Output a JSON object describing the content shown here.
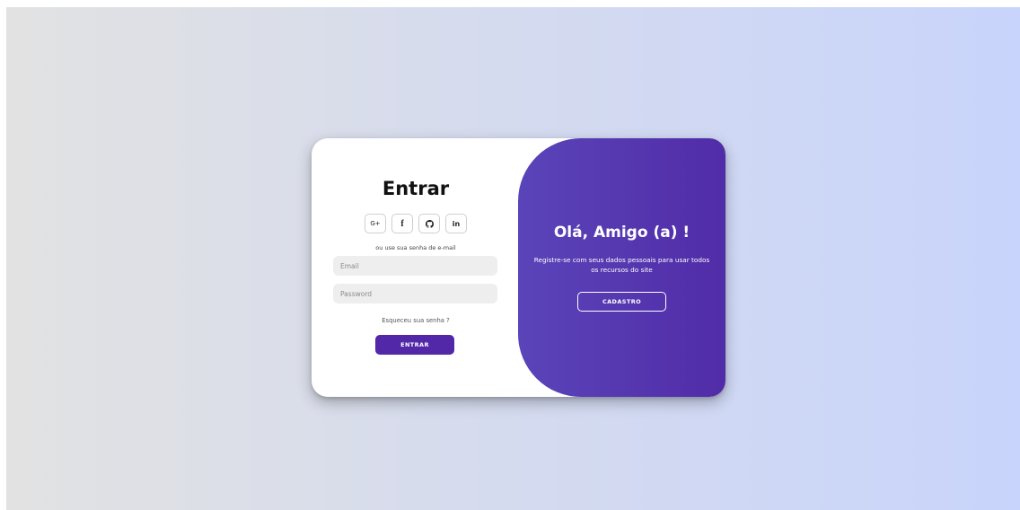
{
  "login": {
    "title": "Entrar",
    "social": {
      "google": "G+",
      "facebook": "f",
      "github": "○",
      "linkedin": "in"
    },
    "hint": "ou use sua senha de e-mail",
    "email_placeholder": "Email",
    "password_placeholder": "Password",
    "forgot": "Esqueceu sua senha ?",
    "submit_label": "ENTRAR"
  },
  "toggle": {
    "title": "Olá, Amigo (a) !",
    "text": "Registre-se com seus dados pessoais para usar todos os recursos do site",
    "register_label": "CADASTRO"
  },
  "colors": {
    "accent": "#5227a8",
    "panel_gradient_start": "#5a44b9",
    "panel_gradient_end": "#512ca8"
  },
  "icons": {
    "google": "google-plus-icon",
    "facebook": "facebook-icon",
    "github": "github-icon",
    "linkedin": "linkedin-icon"
  }
}
